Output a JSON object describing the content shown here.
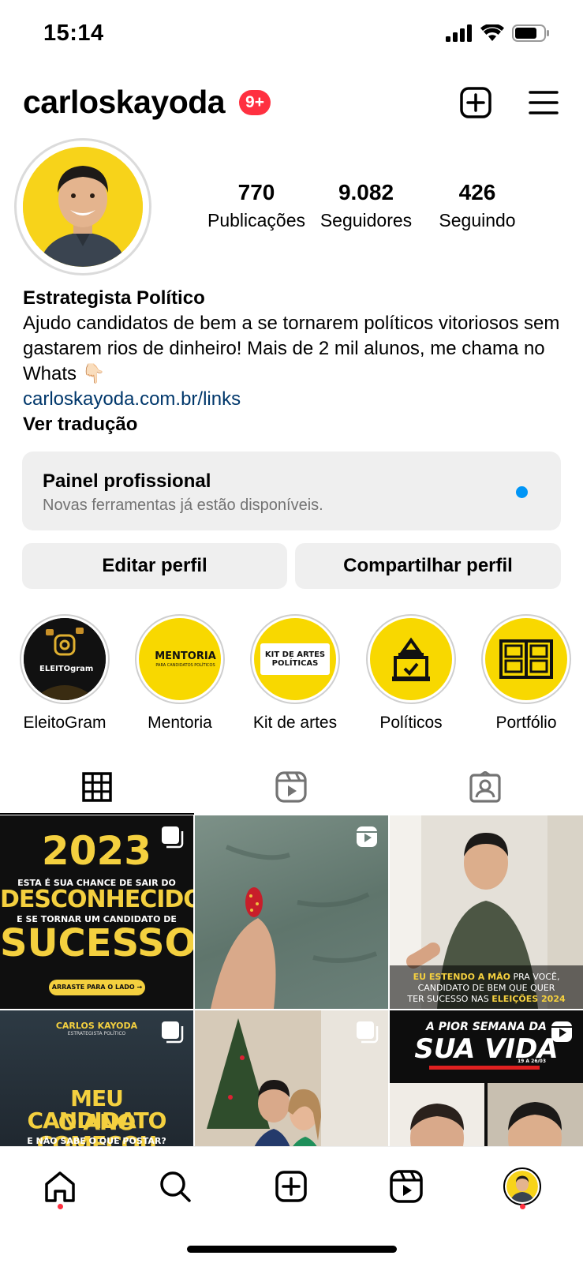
{
  "status_bar": {
    "time": "15:14"
  },
  "header": {
    "username": "carloskayoda",
    "notification_badge": "9+"
  },
  "profile": {
    "stats": [
      {
        "value": "770",
        "label": "Publicações"
      },
      {
        "value": "9.082",
        "label": "Seguidores"
      },
      {
        "value": "426",
        "label": "Seguindo"
      }
    ],
    "bio": {
      "name": "Estrategista Político",
      "text": "Ajudo candidatos de bem a se tornarem políticos vitoriosos sem gastarem rios de dinheiro! Mais de 2 mil alunos, me chama no Whats 👇🏻",
      "link": "carloskayoda.com.br/links",
      "translate": "Ver tradução"
    }
  },
  "pro_panel": {
    "title": "Painel profissional",
    "subtitle": "Novas ferramentas já estão disponíveis."
  },
  "actions": {
    "edit": "Editar perfil",
    "share": "Compartilhar perfil"
  },
  "highlights": [
    {
      "label": "EleitoGram",
      "cover_text": "ELEITOgram"
    },
    {
      "label": "Mentoria",
      "cover_text": "MENTORIA",
      "cover_sub": "PARA CANDIDATOS POLÍTICOS"
    },
    {
      "label": "Kit de artes",
      "cover_text": "KIT DE ARTES POLÍTICAS"
    },
    {
      "label": "Políticos"
    },
    {
      "label": "Portfólio"
    }
  ],
  "tabs": [
    "grid",
    "reels",
    "tagged"
  ],
  "posts": [
    {
      "type": "carousel",
      "line1": "2023",
      "line2": "ESTA É SUA CHANCE DE SAIR DO",
      "line3": "DESCONHECIDO",
      "line4": "E SE TORNAR UM CANDIDATO DE",
      "line5": "SUCESSO",
      "cta": "ARRASTE PARA O LADO →"
    },
    {
      "type": "reel"
    },
    {
      "type": "photo",
      "caption_hl1": "EU ESTENDO A MÃO",
      "caption_1": " PRA VOCÊ,",
      "caption_2": "CANDIDATO DE BEM QUE QUER",
      "caption_3a": "TER SUCESSO NAS ",
      "caption_hl2": "ELEIÇÕES 2024"
    },
    {
      "type": "carousel",
      "brand": "CARLOS KAYODA",
      "brand_sub": "ESTRATEGISTA POLÍTICO",
      "line1": "MEU CANDIDATO",
      "line2": "O ANO COMEÇOU",
      "line3": "E NÃO SABE O QUE POSTAR?"
    },
    {
      "type": "carousel"
    },
    {
      "type": "reel",
      "line1": "A PIOR SEMANA DA",
      "line2": "SUA VIDA",
      "line3": "19 A 26/03"
    }
  ],
  "colors": {
    "accent_blue": "#0095f6",
    "badge_red": "#ff3040",
    "link": "#00376b",
    "brand_yellow": "#f8d800"
  }
}
